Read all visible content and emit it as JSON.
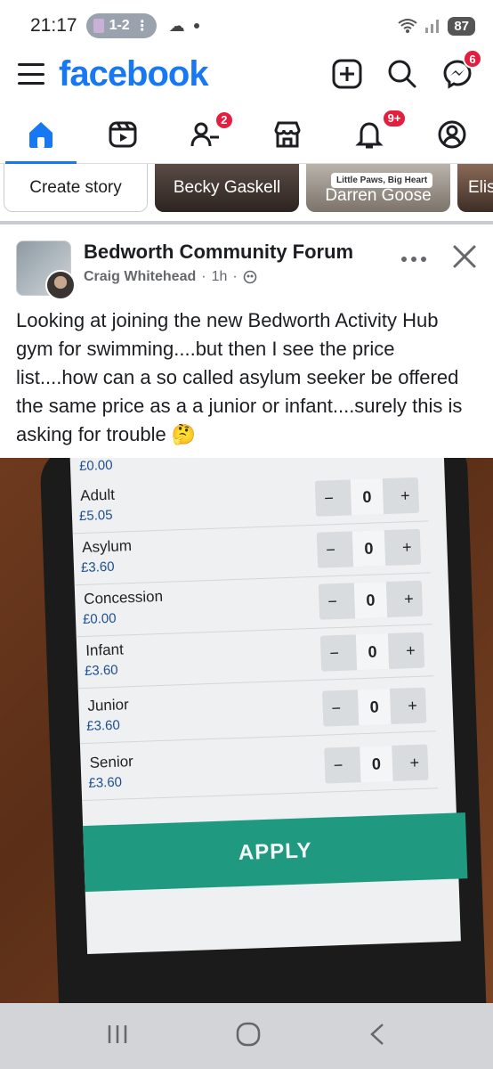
{
  "status_bar": {
    "time": "21:17",
    "sim_label": "1-2",
    "battery": "87"
  },
  "header": {
    "logo": "facebook",
    "messenger_badge": "6"
  },
  "nav": {
    "friends_badge": "2",
    "notifications_badge": "9+"
  },
  "stories": {
    "create_label": "Create story",
    "items": [
      "Becky Gaskell",
      "Darren Goose",
      "Elis"
    ],
    "mini_ad_text": "Little Paws, Big Heart"
  },
  "post": {
    "group_name": "Bedworth Community Forum",
    "author": "Craig Whitehead",
    "time": "1h",
    "separator": "·",
    "text": "Looking at joining the new Bedworth Activity Hub gym for swimming....but then I see the price list....how can a so called asylum seeker be offered the same  price as a a junior or infant....surely this is asking for trouble 🤔"
  },
  "photo": {
    "top_amount": "£0.00",
    "rows": [
      {
        "name": "Adult",
        "price": "£5.05",
        "qty": "0"
      },
      {
        "name": "Asylum",
        "price": "£3.60",
        "qty": "0"
      },
      {
        "name": "Concession",
        "price": "£0.00",
        "qty": "0"
      },
      {
        "name": "Infant",
        "price": "£3.60",
        "qty": "0"
      },
      {
        "name": "Junior",
        "price": "£3.60",
        "qty": "0"
      },
      {
        "name": "Senior",
        "price": "£3.60",
        "qty": "0"
      }
    ],
    "minus": "−",
    "plus": "+",
    "apply_label": "APPLY"
  },
  "colors": {
    "brand": "#1877f2",
    "badge": "#e41e3f",
    "apply": "#1f9a80"
  }
}
